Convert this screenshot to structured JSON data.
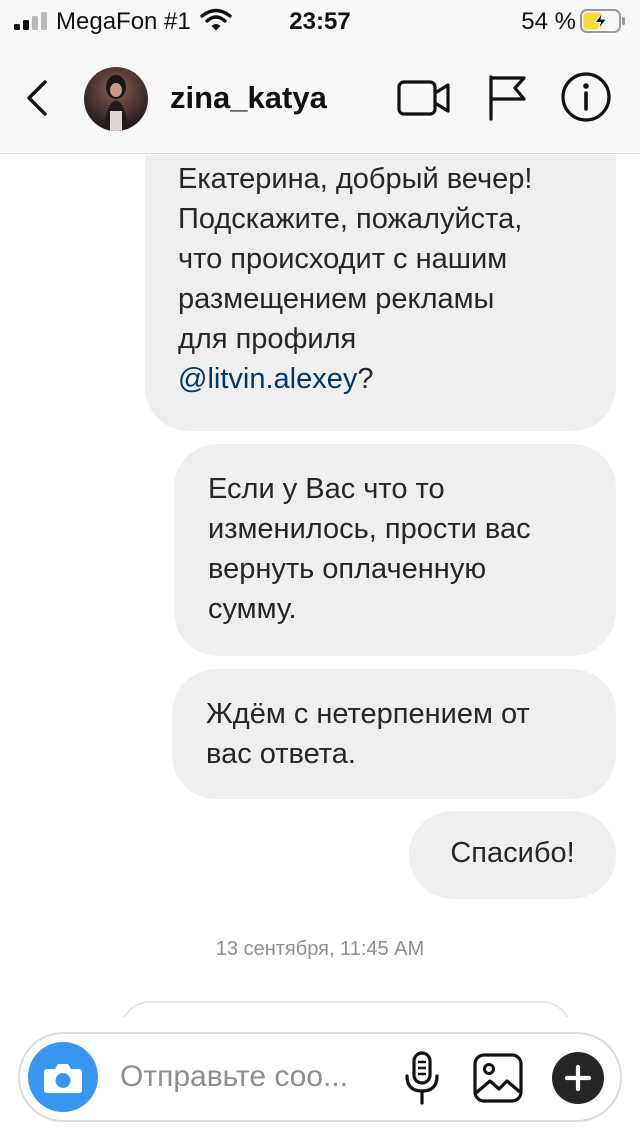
{
  "status_bar": {
    "carrier": "MegaFon #1",
    "time": "23:57",
    "battery_percent": "54 %",
    "battery_level": 0.54,
    "icons": [
      "cellular-signal-icon",
      "wifi-icon",
      "battery-charging-icon"
    ]
  },
  "header": {
    "username": "zina_katya",
    "icons": [
      "back-chevron-icon",
      "avatar",
      "video-camera-icon",
      "flag-icon",
      "info-icon"
    ]
  },
  "messages": [
    {
      "lines": [
        "Екатерина, добрый вечер!",
        "Подскажите, пожалуйста,",
        "что происходит с нашим",
        "размещением рекламы",
        "для профиля"
      ],
      "mention": "@litvin.alexey",
      "suffix": "?"
    },
    {
      "lines": [
        "Если у Вас что то",
        "изменилось, прости вас",
        "вернуть оплаченную",
        "сумму."
      ]
    },
    {
      "lines": [
        "Ждём с нетерпением от",
        "вас ответа."
      ]
    },
    {
      "lines": [
        "Спасибо!"
      ]
    }
  ],
  "timestamp": "13 сентября, 11:45 AM",
  "composer": {
    "placeholder": "Отправьте соо...",
    "value": "",
    "icons": [
      "camera-icon",
      "microphone-icon",
      "gallery-icon",
      "plus-icon"
    ]
  },
  "colors": {
    "accent_blue": "#3797f0",
    "mention_blue": "#00376b",
    "bubble_gray": "#efefef",
    "battery_charge": "#f6d93b",
    "text_dark": "#262626",
    "text_muted": "#8e8e8e"
  }
}
